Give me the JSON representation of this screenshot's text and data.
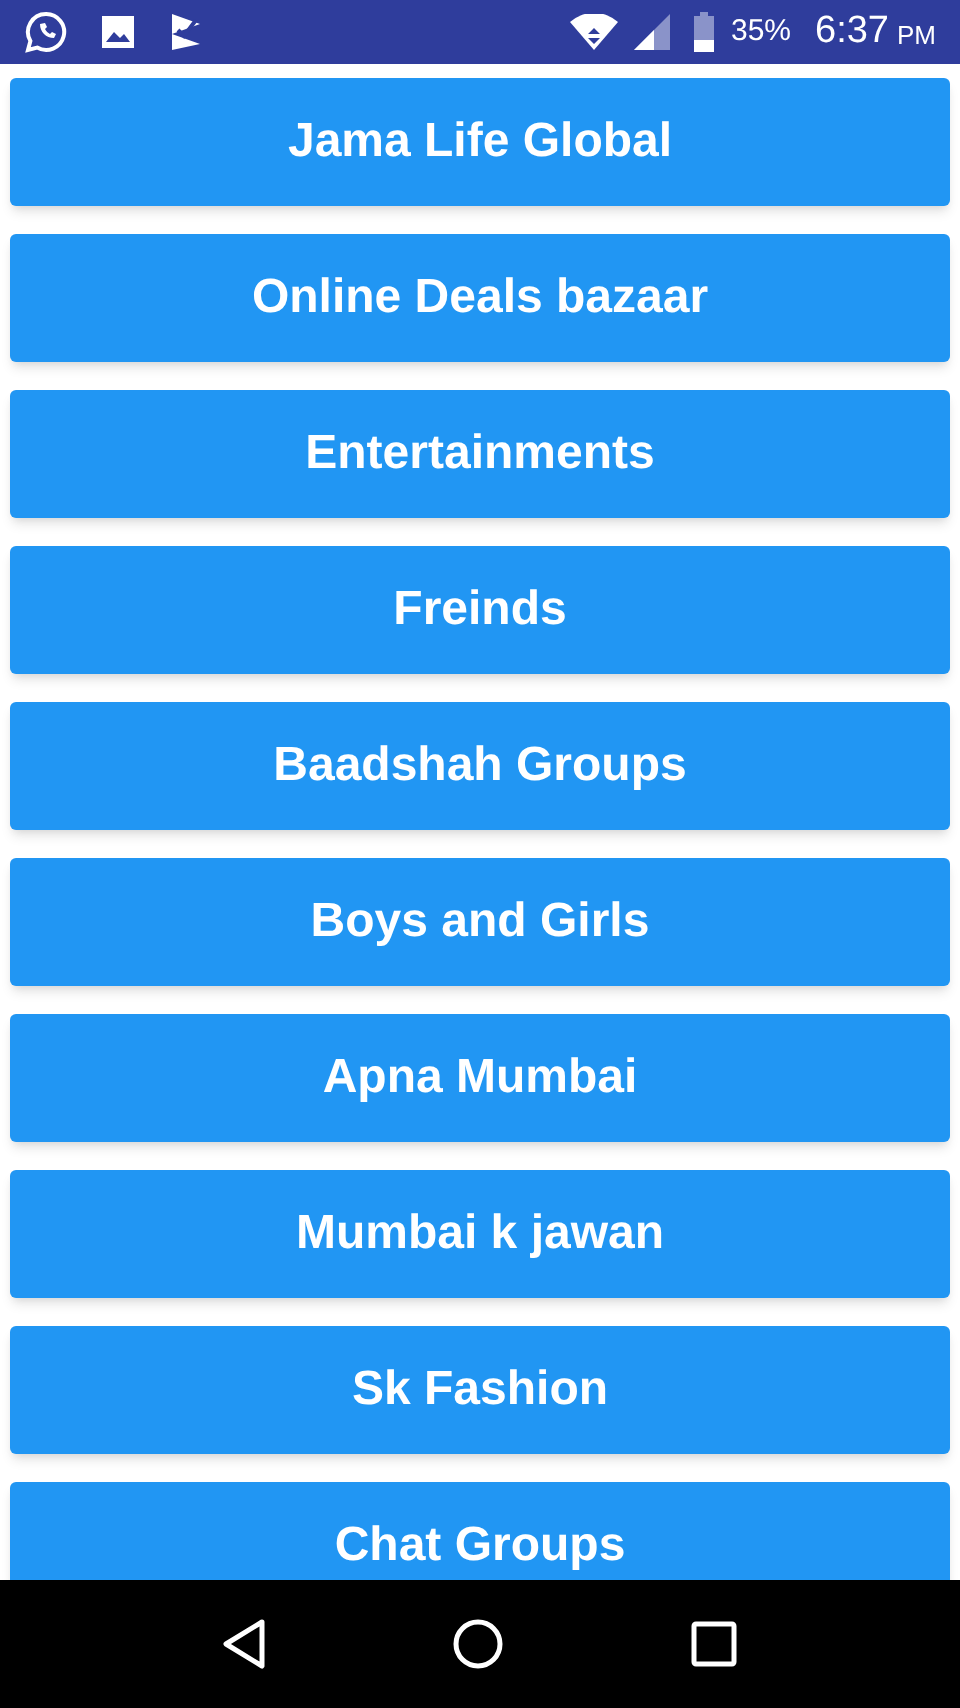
{
  "status_bar": {
    "battery": "35%",
    "time": "6:37",
    "meridiem": "PM"
  },
  "buttons": [
    {
      "label": "Jama Life Global"
    },
    {
      "label": "Online Deals bazaar"
    },
    {
      "label": "Entertainments"
    },
    {
      "label": "Freinds"
    },
    {
      "label": "Baadshah Groups"
    },
    {
      "label": "Boys and Girls"
    },
    {
      "label": "Apna Mumbai"
    },
    {
      "label": "Mumbai k jawan"
    },
    {
      "label": "Sk Fashion"
    },
    {
      "label": "Chat Groups"
    }
  ]
}
